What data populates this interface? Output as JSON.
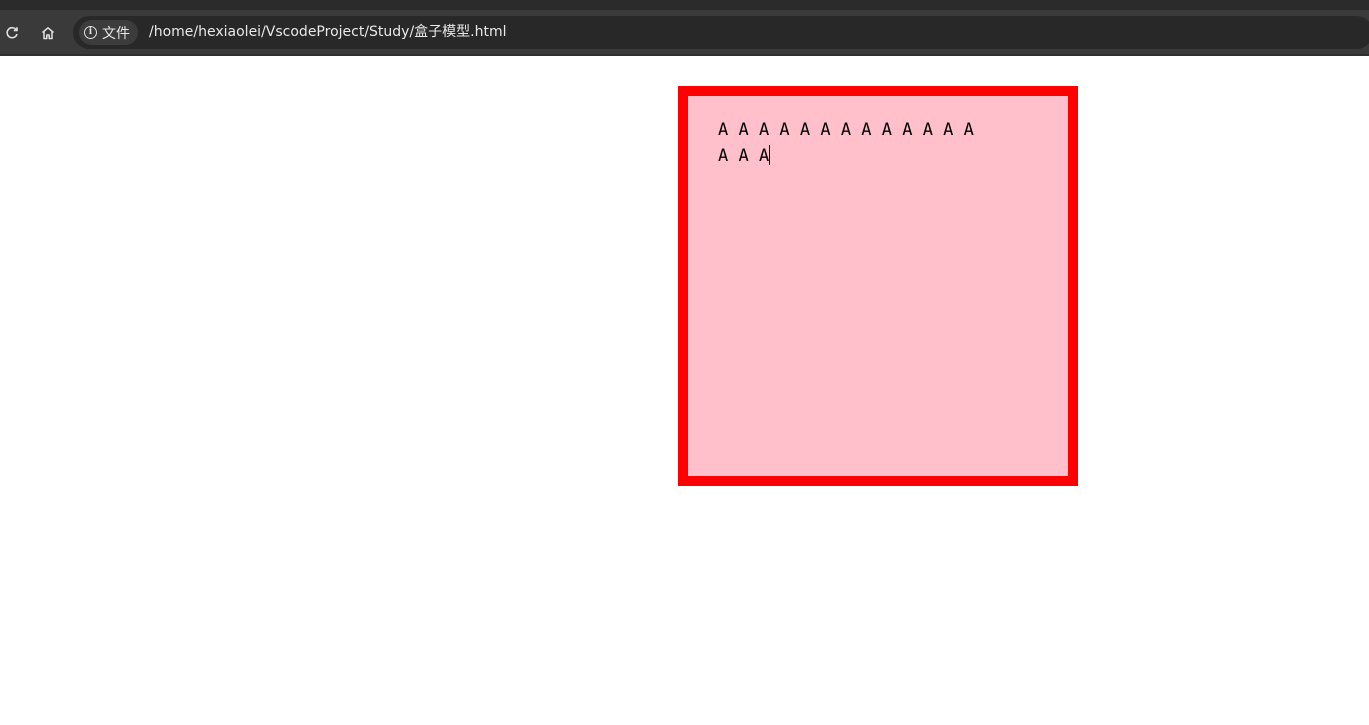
{
  "browser": {
    "site_chip_label": "文件",
    "url": "/home/hexiaolei/VscodeProject/Study/盒子模型.html",
    "icons": {
      "reload": "reload-icon",
      "home": "home-icon",
      "info": "info-icon"
    }
  },
  "page": {
    "box_line1": "A A A A A A A A A A A A A",
    "box_line2": "A A A",
    "colors": {
      "box_border": "#ff0000",
      "box_background": "#ffc0cb"
    }
  }
}
